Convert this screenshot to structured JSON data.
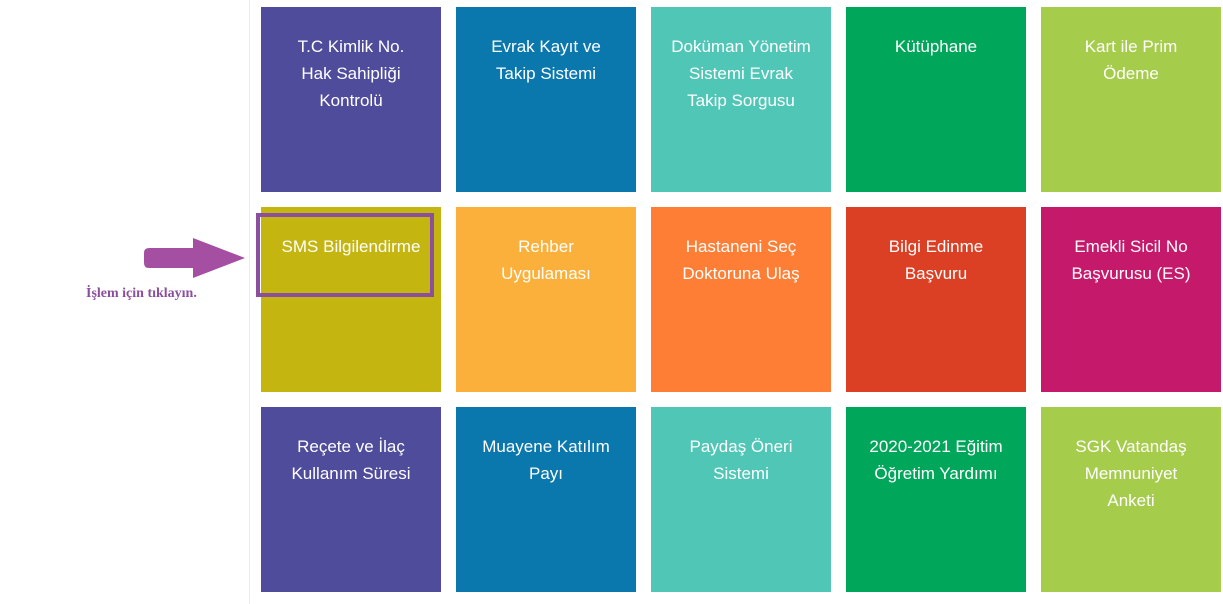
{
  "colors": {
    "purple": "#4f4c9b",
    "blue": "#0a77ad",
    "teal": "#4fc6b6",
    "green": "#00a65a",
    "lime": "#a5cc4b",
    "olive": "#c4b511",
    "yellow": "#fbb03b",
    "orange": "#fd7e34",
    "red": "#db4025",
    "magenta": "#c51a6c",
    "annotation": "#8b4f9e"
  },
  "tiles": [
    {
      "name": "tile-tc-kimlik",
      "lines": [
        "T.C Kimlik No.",
        "Hak Sahipliği",
        "Kontrolü"
      ],
      "color": "#4f4c9b"
    },
    {
      "name": "tile-evrak-kayit",
      "lines": [
        "Evrak Kayıt ve",
        "Takip Sistemi"
      ],
      "color": "#0a77ad"
    },
    {
      "name": "tile-dokuman-yonetim",
      "lines": [
        "Doküman Yönetim",
        "Sistemi Evrak",
        "Takip Sorgusu"
      ],
      "color": "#4fc6b6"
    },
    {
      "name": "tile-kutuphane",
      "lines": [
        "Kütüphane"
      ],
      "color": "#00a65a"
    },
    {
      "name": "tile-kart-ile-prim",
      "lines": [
        "Kart ile Prim",
        "Ödeme"
      ],
      "color": "#a5cc4b"
    },
    {
      "name": "tile-sms-bilgilendirme",
      "lines": [
        "SMS Bilgilendirme"
      ],
      "color": "#c4b511"
    },
    {
      "name": "tile-rehber-uygulamasi",
      "lines": [
        "Rehber",
        "Uygulaması"
      ],
      "color": "#fbb03b"
    },
    {
      "name": "tile-hastaneni-sec",
      "lines": [
        "Hastaneni Seç",
        "Doktoruna Ulaş"
      ],
      "color": "#fd7e34"
    },
    {
      "name": "tile-bilgi-edinme",
      "lines": [
        "Bilgi Edinme",
        "Başvuru"
      ],
      "color": "#db4025"
    },
    {
      "name": "tile-emekli-sicil",
      "lines": [
        "Emekli Sicil No",
        "Başvurusu (ES)"
      ],
      "color": "#c51a6c"
    },
    {
      "name": "tile-recete-ilac",
      "lines": [
        "Reçete ve İlaç",
        "Kullanım Süresi"
      ],
      "color": "#4f4c9b"
    },
    {
      "name": "tile-muayene-katilim",
      "lines": [
        "Muayene Katılım",
        "Payı"
      ],
      "color": "#0a77ad"
    },
    {
      "name": "tile-paydas-oneri",
      "lines": [
        "Paydaş Öneri",
        "Sistemi"
      ],
      "color": "#4fc6b6"
    },
    {
      "name": "tile-egitim-ogretim",
      "lines": [
        "2020-2021 Eğitim",
        "Öğretim Yardımı"
      ],
      "color": "#00a65a"
    },
    {
      "name": "tile-sgk-vatandas",
      "lines": [
        "SGK Vatandaş",
        "Memnuniyet",
        "Anketi"
      ],
      "color": "#a5cc4b"
    }
  ],
  "annotation": {
    "hint_text": "İşlem için tıklayın.",
    "arrow_icon": "right-arrow-icon"
  }
}
